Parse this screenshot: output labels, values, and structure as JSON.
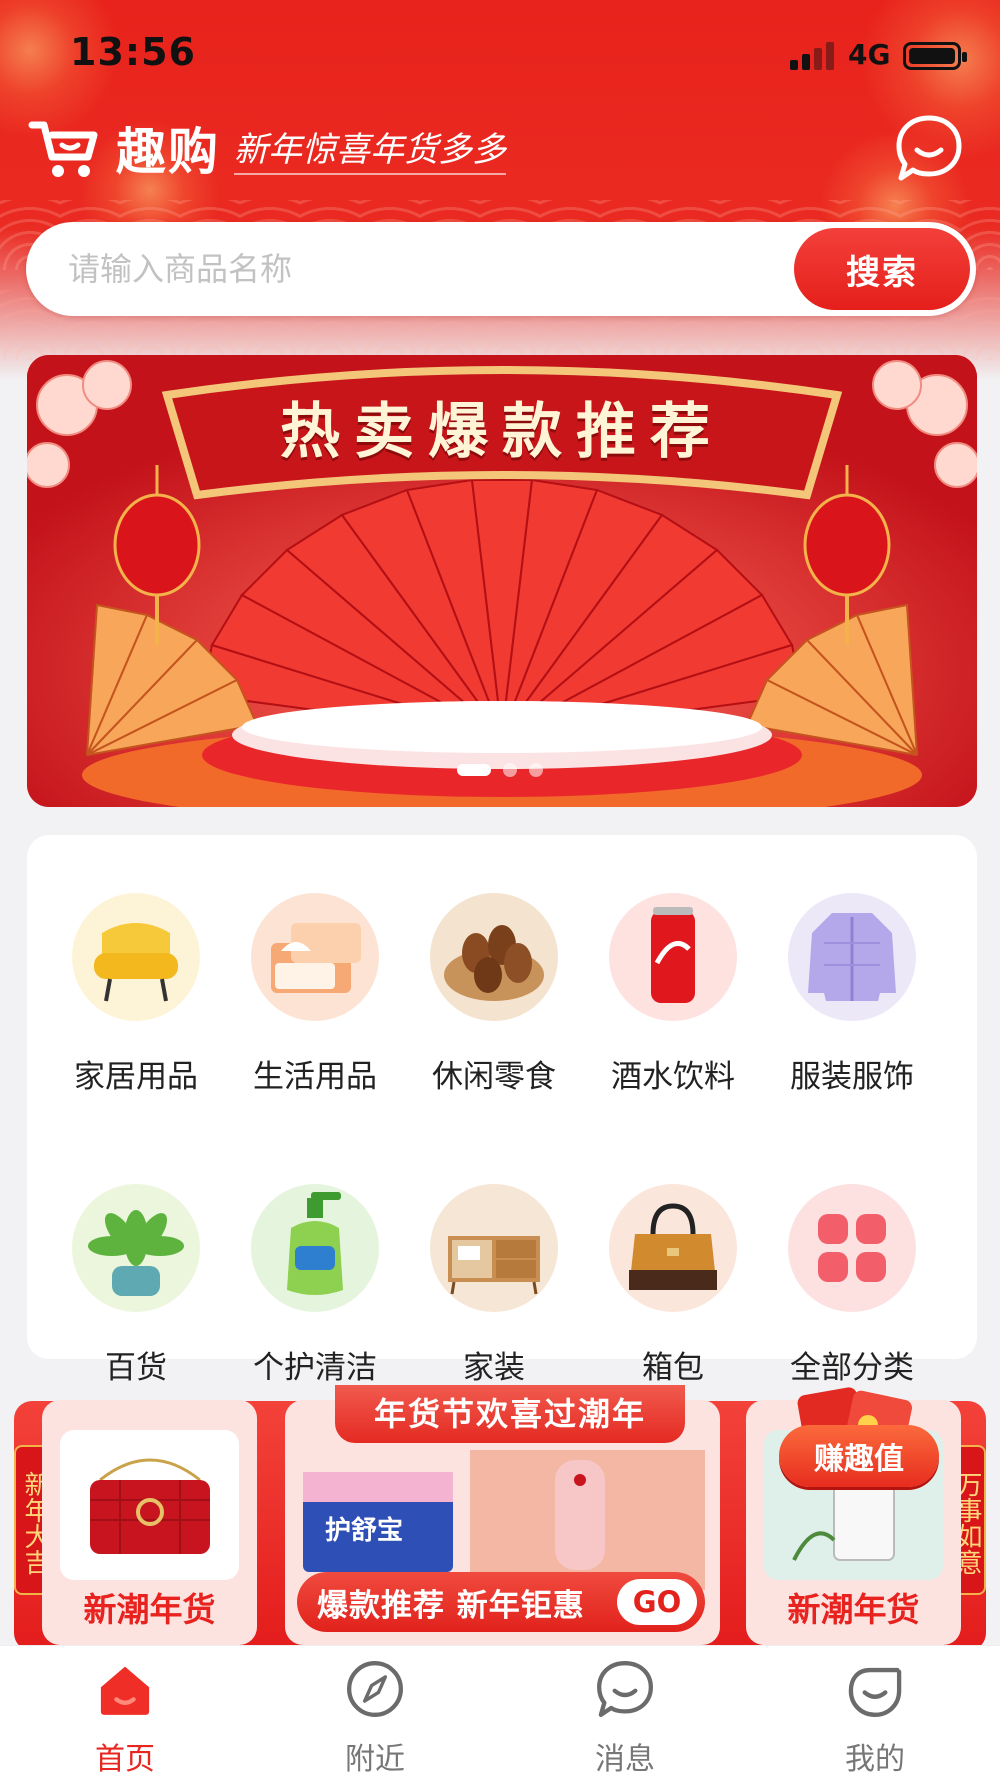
{
  "status_bar": {
    "time": "13:56",
    "network": "4G"
  },
  "header": {
    "brand_name": "趣购",
    "slogan": "新年惊喜年货多多",
    "chat_icon": "chat-bubble-icon",
    "cart_icon": "shopping-cart-icon"
  },
  "search": {
    "placeholder": "请输入商品名称",
    "button_label": "搜索"
  },
  "banner": {
    "title": "热卖爆款推荐",
    "slides": 3,
    "active_slide": 1
  },
  "categories": [
    {
      "label": "家居用品",
      "icon": "armchair-icon"
    },
    {
      "label": "生活用品",
      "icon": "tissue-box-icon"
    },
    {
      "label": "休闲零食",
      "icon": "pecan-nuts-icon"
    },
    {
      "label": "酒水饮料",
      "icon": "cola-can-icon"
    },
    {
      "label": "服装服饰",
      "icon": "puffer-jacket-icon"
    },
    {
      "label": "百货",
      "icon": "succulent-plant-icon"
    },
    {
      "label": "个护清洁",
      "icon": "soap-bottle-icon"
    },
    {
      "label": "家装",
      "icon": "cabinet-icon"
    },
    {
      "label": "箱包",
      "icon": "handbag-icon"
    },
    {
      "label": "全部分类",
      "icon": "grid-four-icon"
    }
  ],
  "promo": {
    "left_tag": "新年大吉",
    "right_tag": "万事如意",
    "left_caption": "新潮年货",
    "right_caption": "新潮年货",
    "center_title": "年货节欢喜过潮年",
    "center_bar": "爆款推荐 新年钜惠",
    "go_label": "GO",
    "earn_label": "赚趣值",
    "product_brand": "护舒宝"
  },
  "bottom_nav": [
    {
      "label": "首页",
      "icon": "home-icon",
      "active": true
    },
    {
      "label": "附近",
      "icon": "compass-icon",
      "active": false
    },
    {
      "label": "消息",
      "icon": "message-icon",
      "active": false
    },
    {
      "label": "我的",
      "icon": "profile-icon",
      "active": false
    }
  ],
  "colors": {
    "primary": "#e8231f",
    "accent_gold": "#f3b24a",
    "page_bg": "#f2f2f4"
  }
}
